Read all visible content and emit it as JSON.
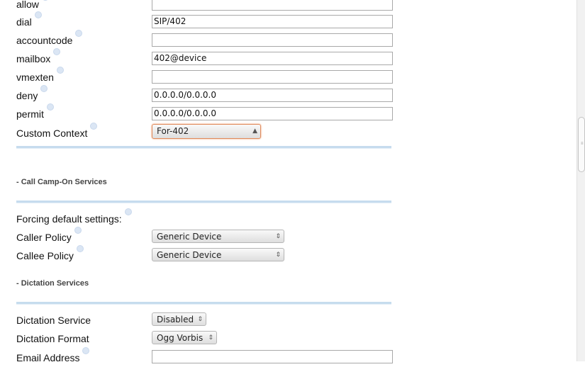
{
  "fields": {
    "allow": {
      "label": "allow",
      "value": ""
    },
    "dial": {
      "label": "dial",
      "value": "SIP/402"
    },
    "accountcode": {
      "label": "accountcode",
      "value": ""
    },
    "mailbox": {
      "label": "mailbox",
      "value": "402@device"
    },
    "vmexten": {
      "label": "vmexten",
      "value": ""
    },
    "deny": {
      "label": "deny",
      "value": "0.0.0.0/0.0.0.0"
    },
    "permit": {
      "label": "permit",
      "value": "0.0.0.0/0.0.0.0"
    },
    "custom_context": {
      "label": "Custom Context",
      "value": "For-402"
    }
  },
  "camp_on": {
    "section_title": "- Call Camp-On Services",
    "forcing_label": "Forcing default settings:",
    "caller_policy": {
      "label": "Caller Policy",
      "value": "Generic Device"
    },
    "callee_policy": {
      "label": "Callee Policy",
      "value": "Generic Device"
    }
  },
  "dictation": {
    "section_title": "- Dictation Services",
    "service": {
      "label": "Dictation Service",
      "value": "Disabled"
    },
    "format": {
      "label": "Dictation Format",
      "value": "Ogg Vorbis"
    },
    "email": {
      "label": "Email Address",
      "value": ""
    }
  },
  "icons": {
    "help": "help-icon",
    "select_arrows": "up-down-arrows-icon"
  },
  "colors": {
    "separator": "#c6dcee",
    "focus_border": "#e08a5c",
    "help_dot": "#dbe6f4"
  }
}
